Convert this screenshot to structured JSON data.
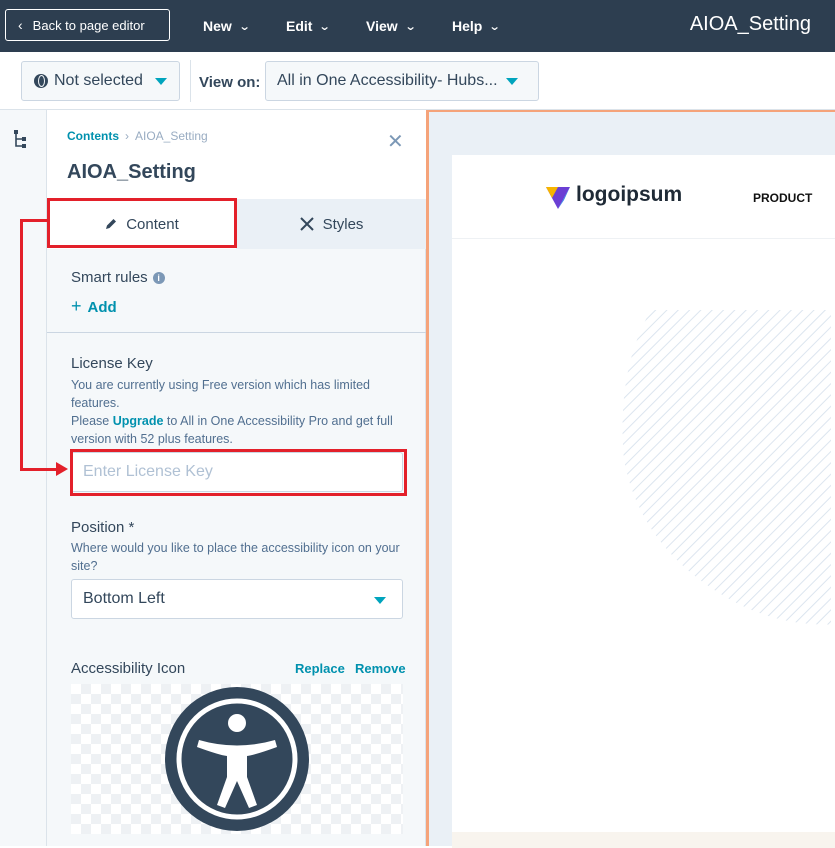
{
  "header": {
    "back_label": "Back to page editor",
    "menus": [
      {
        "label": "New"
      },
      {
        "label": "Edit"
      },
      {
        "label": "View"
      },
      {
        "label": "Help"
      }
    ],
    "app_title": "AIOA_Setting"
  },
  "toolbar": {
    "selection_label": "Not selected",
    "view_on_label": "View on:",
    "view_on_value": "All in One Accessibility- Hubs..."
  },
  "panel": {
    "breadcrumb": {
      "root": "Contents",
      "current": "AIOA_Setting"
    },
    "title": "AIOA_Setting",
    "tabs": [
      {
        "label": "Content"
      },
      {
        "label": "Styles"
      }
    ],
    "smart_rules": {
      "label": "Smart rules",
      "add_label": "Add"
    },
    "license": {
      "label": "License Key",
      "help_line1": "You are currently using Free version which has limited features.",
      "help_please": "Please",
      "upgrade_link": "Upgrade",
      "help_line2": "to All in One Accessibility Pro and get full version with 52 plus features.",
      "placeholder": "Enter License Key"
    },
    "position": {
      "label": "Position *",
      "help": "Where would you like to place the accessibility icon on your site?",
      "value": "Bottom Left"
    },
    "accessibility_icon": {
      "label": "Accessibility Icon",
      "replace_label": "Replace",
      "remove_label": "Remove"
    }
  },
  "preview": {
    "logo_text": "logoipsum",
    "nav_item": "PRODUCT"
  },
  "colors": {
    "topbar": "#2d3e50",
    "accent_teal": "#00a4bd",
    "link": "#0091ae",
    "annotation_red": "#e3202a",
    "preview_border": "#f5a37a"
  }
}
